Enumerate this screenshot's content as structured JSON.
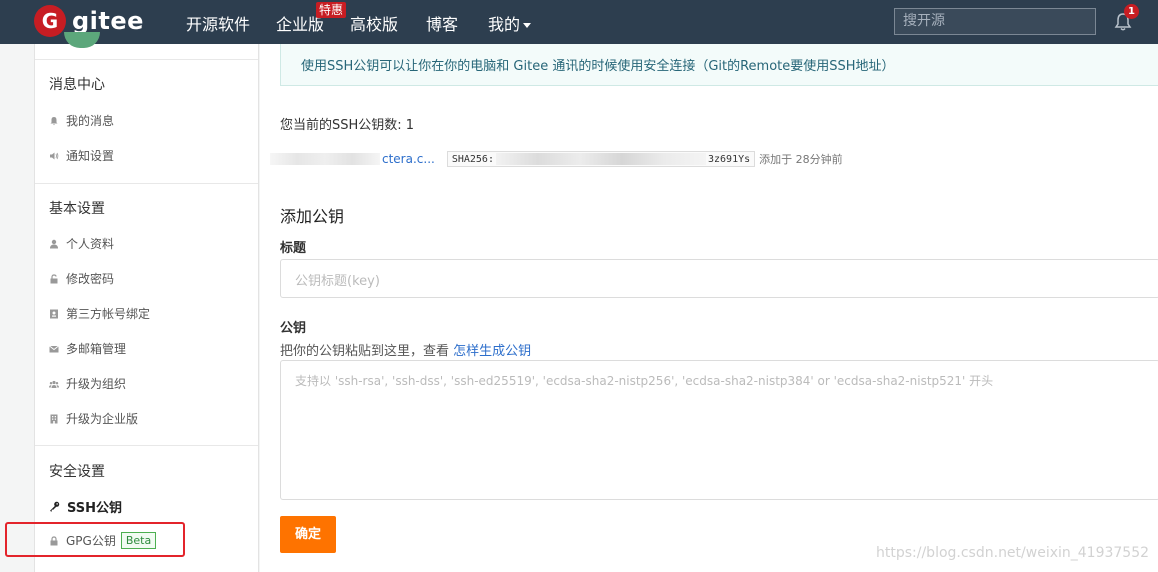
{
  "nav": {
    "logo_letter": "G",
    "logo_text": "gitee",
    "items": [
      "开源软件",
      "企业版",
      "高校版",
      "博客",
      "我的"
    ],
    "promo_badge": "特惠",
    "search_placeholder": "搜开源",
    "notification_count": "1",
    "brand_color": "#c71d23",
    "bar_color": "#2d3e4f"
  },
  "sidebar": {
    "sections": [
      {
        "title": "消息中心",
        "items": [
          {
            "label": "我的消息",
            "icon": "bell-icon"
          },
          {
            "label": "通知设置",
            "icon": "speaker-icon"
          }
        ]
      },
      {
        "title": "基本设置",
        "items": [
          {
            "label": "个人资料",
            "icon": "user-icon"
          },
          {
            "label": "修改密码",
            "icon": "unlock-icon"
          },
          {
            "label": "第三方帐号绑定",
            "icon": "id-card-icon"
          },
          {
            "label": "多邮箱管理",
            "icon": "envelope-icon"
          },
          {
            "label": "升级为组织",
            "icon": "users-icon"
          },
          {
            "label": "升级为企业版",
            "icon": "building-icon"
          }
        ]
      },
      {
        "title": "安全设置",
        "items": [
          {
            "label": "SSH公钥",
            "icon": "key-icon",
            "active": true
          },
          {
            "label": "GPG公钥",
            "icon": "lock-icon",
            "badge": "Beta"
          }
        ]
      }
    ]
  },
  "main": {
    "info_text": "使用SSH公钥可以让你在你的电脑和 Gitee 通讯的时候使用安全连接（Git的Remote要使用SSH地址）",
    "key_count_text": "您当前的SSH公钥数: 1",
    "key": {
      "title_suffix": "ctera.c...",
      "sha_prefix": "SHA256:",
      "sha_suffix": "3z691Ys",
      "added_text": "添加于 28分钟前"
    },
    "add_title": "添加公钥",
    "title_label": "标题",
    "title_placeholder": "公钥标题(key)",
    "key_label": "公钥",
    "key_hint": "把你的公钥粘贴到这里，查看",
    "key_hint_link": "怎样生成公钥",
    "key_placeholder": "支持以 'ssh-rsa', 'ssh-dss', 'ssh-ed25519', 'ecdsa-sha2-nistp256', 'ecdsa-sha2-nistp384' or 'ecdsa-sha2-nistp521' 开头",
    "submit_label": "确定",
    "accent_color": "#fe7300"
  },
  "watermark": "https://blog.csdn.net/weixin_41937552"
}
